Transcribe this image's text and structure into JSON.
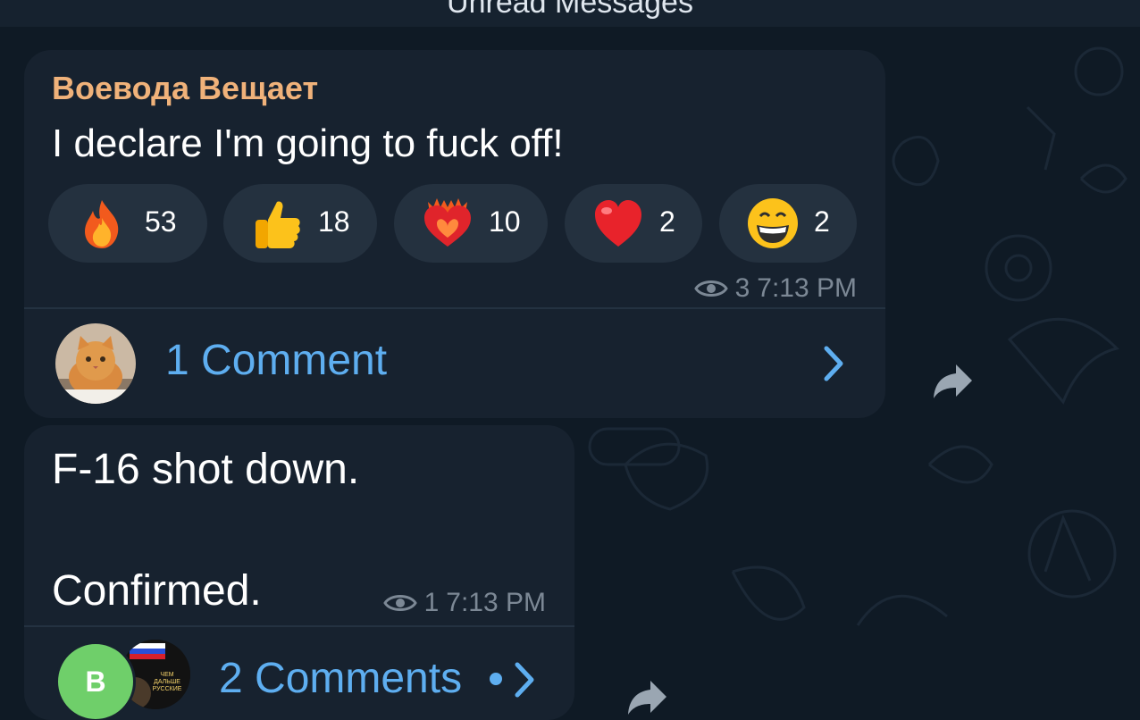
{
  "header": {
    "title": "Unread Messages"
  },
  "messages": [
    {
      "sender": "Воевода Вещает",
      "text": "I declare I'm going to fuck off!",
      "reactions": [
        {
          "icon": "fire-emoji-icon",
          "count": "53"
        },
        {
          "icon": "thumbs-up-emoji-icon",
          "count": "18"
        },
        {
          "icon": "heart-on-fire-emoji-icon",
          "count": "10"
        },
        {
          "icon": "red-heart-emoji-icon",
          "count": "2"
        },
        {
          "icon": "grinning-face-emoji-icon",
          "count": "2"
        }
      ],
      "views": "3",
      "time": "7:13 PM",
      "comments_label": "1 Comment"
    },
    {
      "text_line1": "F-16 shot down.",
      "text_line2": "Confirmed.",
      "views": "1",
      "time": "7:13 PM",
      "comments_label": "2 Comments",
      "avatar_letter": "B",
      "avatar_image_text": "ЧЕМ ДАЛЬШЕ РУССКИЕ"
    }
  ],
  "colors": {
    "background": "#0f1a25",
    "bubble": "#17222f",
    "reaction_pill": "#24313f",
    "sender_name": "#f0b27a",
    "link": "#5eaef0",
    "meta_text": "#7c8895",
    "avatar_green": "#6fcf6a"
  }
}
